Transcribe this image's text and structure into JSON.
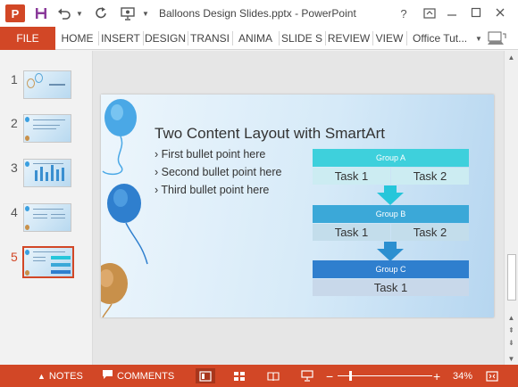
{
  "window": {
    "title": "Balloons Design Slides.pptx - PowerPoint",
    "help_glyph": "?",
    "app_logo_letter": "P"
  },
  "ribbon": {
    "file_label": "FILE",
    "tabs": [
      {
        "label": "HOME"
      },
      {
        "label": "INSERT"
      },
      {
        "label": "DESIGN"
      },
      {
        "label": "TRANSI"
      },
      {
        "label": "ANIMA"
      },
      {
        "label": "SLIDE S"
      },
      {
        "label": "REVIEW"
      },
      {
        "label": "VIEW"
      }
    ],
    "account_label": "Office Tut..."
  },
  "thumbnails": {
    "numbers": [
      "1",
      "2",
      "3",
      "4",
      "5"
    ],
    "selected": "5"
  },
  "slide": {
    "title": "Two Content Layout with SmartArt",
    "bullets": [
      "› First bullet point here",
      "› Second bullet point here",
      "› Third bullet point here"
    ],
    "smartart": {
      "groups": [
        {
          "label": "Group A",
          "tasks": [
            "Task 1",
            "Task 2"
          ]
        },
        {
          "label": "Group B",
          "tasks": [
            "Task 1",
            "Task 2"
          ]
        },
        {
          "label": "Group C",
          "tasks": [
            "Task 1"
          ]
        }
      ]
    }
  },
  "statusbar": {
    "notes_label": "NOTES",
    "comments_label": "COMMENTS",
    "zoom_minus": "−",
    "zoom_plus": "+",
    "zoom_percent": "34%",
    "zoom_level": 0.34
  },
  "colors": {
    "accent": "#d24726",
    "group_a": "#3ed0dc",
    "group_b": "#3ba8d8",
    "group_c": "#2f7fce",
    "task_a": "#ccecf2",
    "task_b": "#c3ddeb",
    "task_c": "#c8d8ea"
  }
}
